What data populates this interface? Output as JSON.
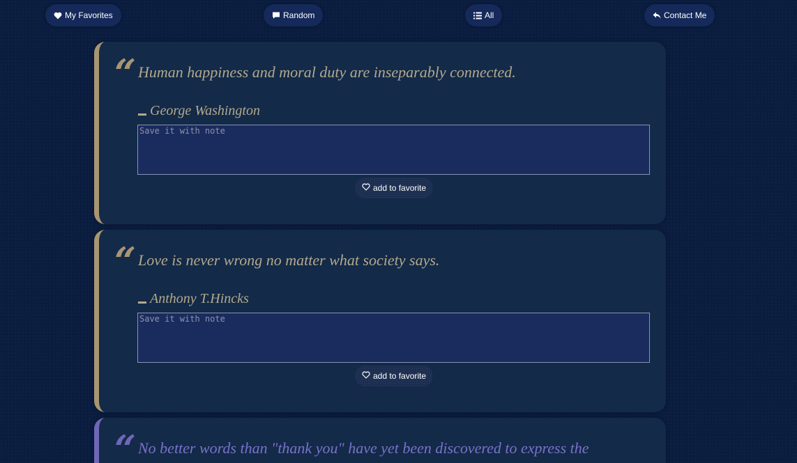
{
  "nav": {
    "favorites_label": "My Favorites",
    "random_label": "Random",
    "all_label": "All",
    "contact_label": "Contact Me"
  },
  "quotes": [
    {
      "text": "Human happiness and moral duty are inseparably connected.",
      "author": "George Washington",
      "note_placeholder": "Save it with note",
      "fav_label": "add to favorite"
    },
    {
      "text": "Love is never wrong no matter what society says.",
      "author": "Anthony T.Hincks",
      "note_placeholder": "Save it with note",
      "fav_label": "add to favorite"
    },
    {
      "text": "No better words than \"thank you\" have yet been discovered to express the"
    }
  ],
  "quote_mark": "“",
  "icons": {
    "favorites": "heart-icon",
    "random": "comment-icon",
    "all": "list-icon",
    "contact": "reply-icon",
    "fav_button": "heart-outline-icon"
  },
  "colors": {
    "background": "#0a1c3d",
    "card": "#132a49",
    "accent": "#a89572",
    "nav_button": "#15295a",
    "faded_accent": "#6f67b8"
  }
}
